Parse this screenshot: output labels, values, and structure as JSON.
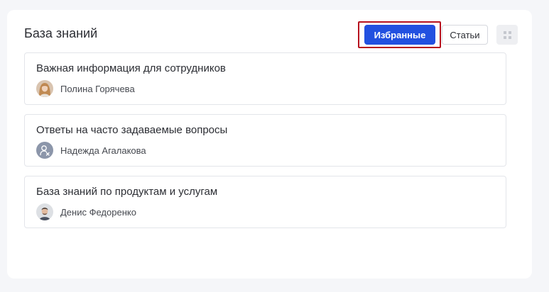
{
  "header": {
    "title": "База знаний"
  },
  "toolbar": {
    "favorites_label": "Избранные",
    "articles_label": "Статьи",
    "grid_icon": "grid-icon"
  },
  "colors": {
    "primary": "#2250e0",
    "highlight": "#b7121e",
    "text": "#2b2d33",
    "border": "#e3e5ea"
  },
  "articles": [
    {
      "title": "Важная информация для сотрудников",
      "author": "Полина Горячева",
      "avatar": "female-photo-avatar"
    },
    {
      "title": "Ответы на часто задаваемые вопросы",
      "author": "Надежда Агалакова",
      "avatar": "placeholder-avatar"
    },
    {
      "title": "База знаний по продуктам и услугам",
      "author": "Денис Федоренко",
      "avatar": "male-photo-avatar"
    }
  ]
}
